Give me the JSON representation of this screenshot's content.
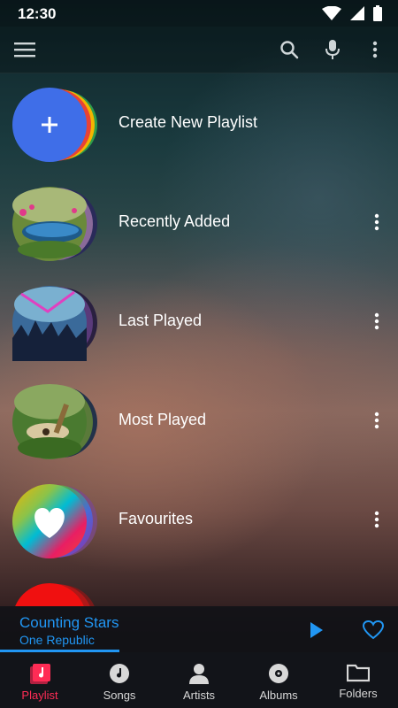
{
  "status_bar": {
    "time": "12:30"
  },
  "toolbar": {
    "menu_icon": "hamburger-menu-icon",
    "search_icon": "search-icon",
    "mic_icon": "microphone-icon",
    "overflow_icon": "more-vertical-icon"
  },
  "playlists": [
    {
      "label": "Create New Playlist"
    },
    {
      "label": "Recently Added"
    },
    {
      "label": "Last Played"
    },
    {
      "label": "Most Played"
    },
    {
      "label": "Favourites"
    }
  ],
  "now_playing": {
    "title": "Counting Stars",
    "artist": "One Republic",
    "progress": 0.3
  },
  "bottom_nav": [
    {
      "label": "Playlist",
      "icon": "playlist-icon",
      "active": true
    },
    {
      "label": "Songs",
      "icon": "song-disc-icon",
      "active": false
    },
    {
      "label": "Artists",
      "icon": "artist-icon",
      "active": false
    },
    {
      "label": "Albums",
      "icon": "album-icon",
      "active": false
    },
    {
      "label": "Folders",
      "icon": "folder-icon",
      "active": false
    }
  ],
  "colors": {
    "accent_blue": "#2196f3",
    "active_nav": "#ff2c55",
    "create_circle": "#3f6ee8"
  }
}
